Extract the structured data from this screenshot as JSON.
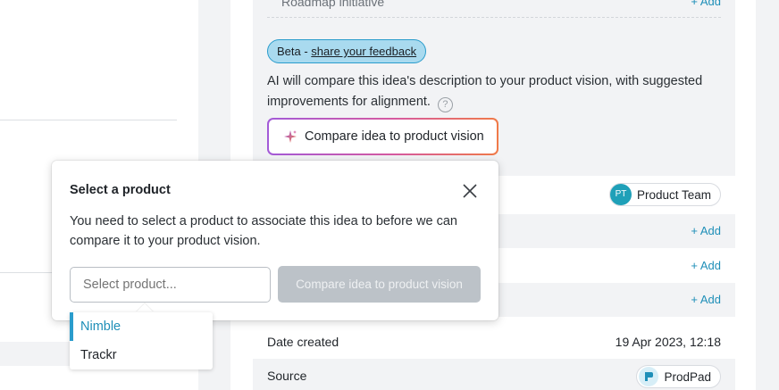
{
  "roadmap": {
    "label": "Roadmap initiative",
    "add_label": "+ Add"
  },
  "ai_panel": {
    "beta_prefix": "Beta - ",
    "feedback_link": "share your feedback",
    "description": "AI will compare this idea's description to your product vision, with suggested improvements for alignment.",
    "help_icon": "?",
    "compare_button": "Compare idea to product vision"
  },
  "details": {
    "product_team_initials": "PT",
    "product_team": "Product Team",
    "add_label_1": "+ Add",
    "add_label_2": "+ Add",
    "add_label_3": "+ Add",
    "date_created_label": "Date created",
    "date_created_value": "19 Apr 2023, 12:18",
    "source_label": "Source",
    "source_value": "ProdPad"
  },
  "modal": {
    "title": "Select a product",
    "body": "You need to select a product to associate this idea to before we can compare it to your product vision.",
    "select_placeholder": "Select product...",
    "compare_button": "Compare idea to product vision"
  },
  "dropdown": {
    "options": [
      "Nimble",
      "Trackr"
    ],
    "active_index": 0
  },
  "colors": {
    "accent": "#2a9ccc",
    "link": "#1f8fb8",
    "disabled_button": "#bcc2c8",
    "avatar": "#1fa0b8"
  }
}
